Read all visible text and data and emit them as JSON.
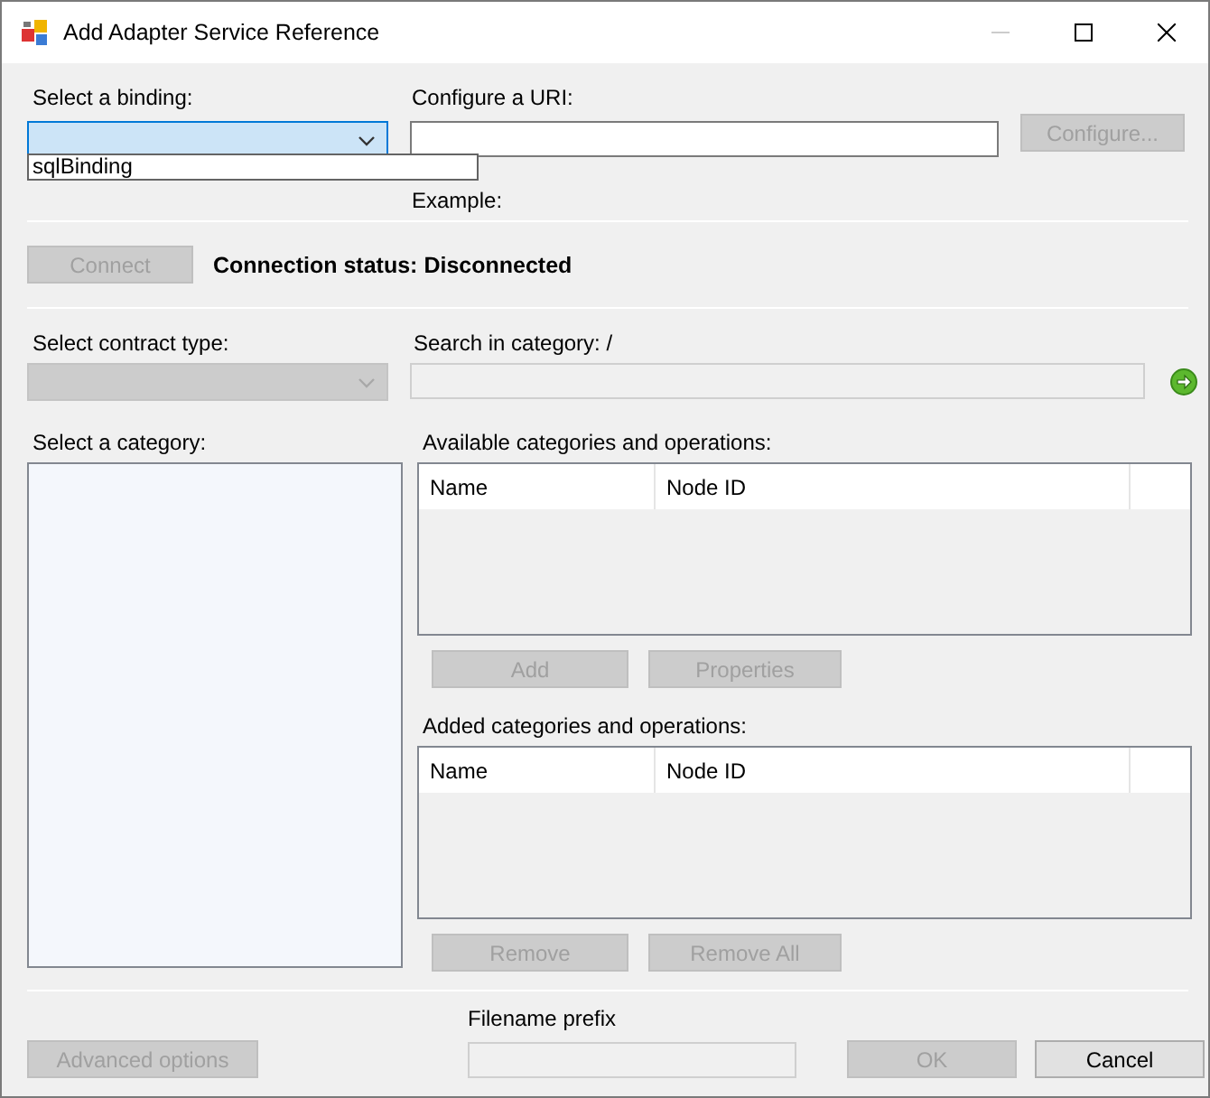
{
  "window": {
    "title": "Add Adapter Service Reference"
  },
  "binding": {
    "label": "Select a binding:",
    "focused": true,
    "expanded": true,
    "options": [
      "sqlBinding"
    ]
  },
  "uri": {
    "label": "Configure a URI:",
    "example": "Example:"
  },
  "configure_button": {
    "label": "Configure...",
    "disabled": true
  },
  "connect_button": {
    "label": "Connect",
    "disabled": true
  },
  "status": {
    "label": "Connection status:",
    "value": "Disconnected"
  },
  "contract_type": {
    "label": "Select contract type:",
    "disabled": true
  },
  "search": {
    "label": "Search in category: /",
    "disabled": true
  },
  "category": {
    "label": "Select a category:"
  },
  "available": {
    "label": "Available categories and operations:",
    "columns": [
      "Name",
      "Node ID"
    ],
    "buttons": [
      {
        "label": "Add",
        "disabled": true
      },
      {
        "label": "Properties",
        "disabled": true
      }
    ]
  },
  "added": {
    "label": "Added categories and operations:",
    "columns": [
      "Name",
      "Node ID"
    ],
    "buttons": [
      {
        "label": "Remove",
        "disabled": true
      },
      {
        "label": "Remove All",
        "disabled": true
      }
    ]
  },
  "advanced_button": {
    "label": "Advanced options",
    "disabled": true
  },
  "filename_prefix": {
    "label": "Filename prefix",
    "disabled": true
  },
  "footer_buttons": [
    {
      "label": "OK",
      "disabled": true
    },
    {
      "label": "Cancel",
      "disabled": false
    }
  ]
}
